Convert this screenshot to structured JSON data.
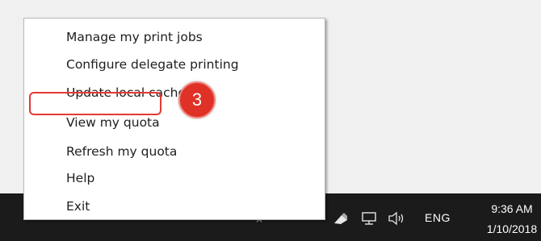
{
  "menu": {
    "items": [
      {
        "label": "Manage my print jobs"
      },
      {
        "label": "Configure delegate printing"
      },
      {
        "label": "Update local cache"
      },
      {
        "label": "View my quota"
      },
      {
        "label": "Refresh my quota"
      },
      {
        "label": "Help"
      },
      {
        "label": "Exit"
      }
    ]
  },
  "annotation": {
    "step_number": "3",
    "color": "#e53935"
  },
  "taskbar": {
    "chevron": "^",
    "icons": [
      "network-printer-icon",
      "network-icon",
      "volume-icon"
    ],
    "language": "ENG",
    "time": "9:36 AM",
    "date": "1/10/2018"
  }
}
